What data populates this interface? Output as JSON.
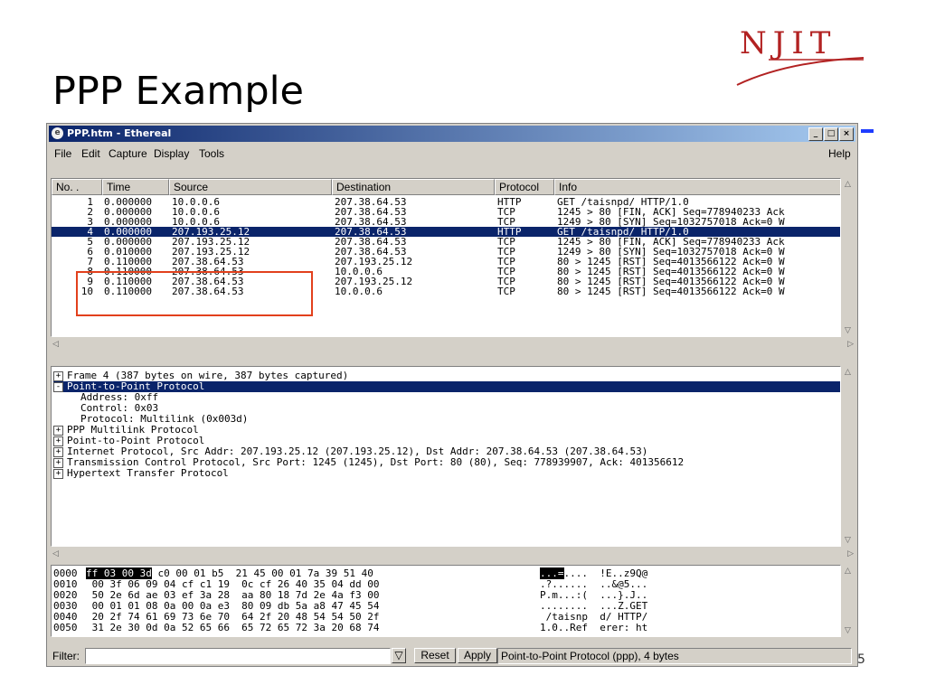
{
  "slide": {
    "title": "PPP Example",
    "logo": "NJIT",
    "page_number": "5"
  },
  "window": {
    "title": "PPP.htm - Ethereal",
    "controls": [
      "_",
      "□",
      "×"
    ]
  },
  "menu": {
    "file": "File",
    "edit": "Edit",
    "capture": "Capture",
    "display": "Display",
    "tools": "Tools",
    "help": "Help"
  },
  "packet_list": {
    "columns": [
      "No. .",
      "Time",
      "Source",
      "Destination",
      "Protocol",
      "Info"
    ],
    "rows": [
      {
        "no": "1",
        "time": "0.000000",
        "source": "10.0.0.6",
        "destination": "207.38.64.53",
        "protocol": "HTTP",
        "info": "GET /taisnpd/ HTTP/1.0"
      },
      {
        "no": "2",
        "time": "0.000000",
        "source": "10.0.0.6",
        "destination": "207.38.64.53",
        "protocol": "TCP",
        "info": "1245 > 80 [FIN, ACK] Seq=778940233 Ack"
      },
      {
        "no": "3",
        "time": "0.000000",
        "source": "10.0.0.6",
        "destination": "207.38.64.53",
        "protocol": "TCP",
        "info": "1249 > 80 [SYN] Seq=1032757018 Ack=0 W"
      },
      {
        "no": "4",
        "time": "0.000000",
        "source": "207.193.25.12",
        "destination": "207.38.64.53",
        "protocol": "HTTP",
        "info": "GET /taisnpd/ HTTP/1.0"
      },
      {
        "no": "5",
        "time": "0.000000",
        "source": "207.193.25.12",
        "destination": "207.38.64.53",
        "protocol": "TCP",
        "info": "1245 > 80 [FIN, ACK] Seq=778940233 Ack"
      },
      {
        "no": "6",
        "time": "0.010000",
        "source": "207.193.25.12",
        "destination": "207.38.64.53",
        "protocol": "TCP",
        "info": "1249 > 80 [SYN] Seq=1032757018 Ack=0 W"
      },
      {
        "no": "7",
        "time": "0.110000",
        "source": "207.38.64.53",
        "destination": "207.193.25.12",
        "protocol": "TCP",
        "info": "80 > 1245 [RST] Seq=4013566122 Ack=0 W"
      },
      {
        "no": "8",
        "time": "0.110000",
        "source": "207.38.64.53",
        "destination": "10.0.0.6",
        "protocol": "TCP",
        "info": "80 > 1245 [RST] Seq=4013566122 Ack=0 W"
      },
      {
        "no": "9",
        "time": "0.110000",
        "source": "207.38.64.53",
        "destination": "207.193.25.12",
        "protocol": "TCP",
        "info": "80 > 1245 [RST] Seq=4013566122 Ack=0 W"
      },
      {
        "no": "10",
        "time": "0.110000",
        "source": "207.38.64.53",
        "destination": "10.0.0.6",
        "protocol": "TCP",
        "info": "80 > 1245 [RST] Seq=4013566122 Ack=0 W"
      }
    ]
  },
  "details": {
    "lines": [
      {
        "expander": "+",
        "text": "Frame 4 (387 bytes on wire, 387 bytes captured)"
      },
      {
        "expander": "-",
        "text": "Point-to-Point Protocol"
      },
      {
        "expander": "",
        "text": "Address: 0xff"
      },
      {
        "expander": "",
        "text": "Control: 0x03"
      },
      {
        "expander": "",
        "text": "Protocol: Multilink (0x003d)"
      },
      {
        "expander": "+",
        "text": "PPP Multilink Protocol"
      },
      {
        "expander": "+",
        "text": "Point-to-Point Protocol"
      },
      {
        "expander": "+",
        "text": "Internet Protocol, Src Addr: 207.193.25.12 (207.193.25.12), Dst Addr: 207.38.64.53 (207.38.64.53)"
      },
      {
        "expander": "+",
        "text": "Transmission Control Protocol, Src Port: 1245 (1245), Dst Port: 80 (80), Seq: 778939907, Ack: 401356612"
      },
      {
        "expander": "+",
        "text": "Hypertext Transfer Protocol"
      }
    ]
  },
  "hex": {
    "rows": [
      {
        "offset": "0000",
        "bytes_hl": "ff 03 00 3d",
        "bytes": " c0 00 01 b5  21 45 00 01 7a 39 51 40",
        "ascii_hl": "...=",
        "ascii": "....  !E..z9Q@"
      },
      {
        "offset": "0010",
        "bytes_hl": "",
        "bytes": " 00 3f 06 09 04 cf c1 19  0c cf 26 40 35 04 dd 00",
        "ascii_hl": "",
        "ascii": ".?......  ..&@5..."
      },
      {
        "offset": "0020",
        "bytes_hl": "",
        "bytes": " 50 2e 6d ae 03 ef 3a 28  aa 80 18 7d 2e 4a f3 00",
        "ascii_hl": "",
        "ascii": "P.m...:(  ...}.J.."
      },
      {
        "offset": "0030",
        "bytes_hl": "",
        "bytes": " 00 01 01 08 0a 00 0a e3  80 09 db 5a a8 47 45 54",
        "ascii_hl": "",
        "ascii": "........  ...Z.GET"
      },
      {
        "offset": "0040",
        "bytes_hl": "",
        "bytes": " 20 2f 74 61 69 73 6e 70  64 2f 20 48 54 54 50 2f",
        "ascii_hl": "",
        "ascii": " /taisnp  d/ HTTP/"
      },
      {
        "offset": "0050",
        "bytes_hl": "",
        "bytes": " 31 2e 30 0d 0a 52 65 66  65 72 65 72 3a 20 68 74",
        "ascii_hl": "",
        "ascii": "1.0..Ref  erer: ht"
      }
    ]
  },
  "filter": {
    "label": "Filter:",
    "value": "",
    "reset": "Reset",
    "apply": "Apply",
    "status": "Point-to-Point Protocol (ppp), 4 bytes"
  },
  "colors": {
    "selection": "#0a246a",
    "highlight_box": "#e2401c",
    "logo": "#b22222"
  }
}
